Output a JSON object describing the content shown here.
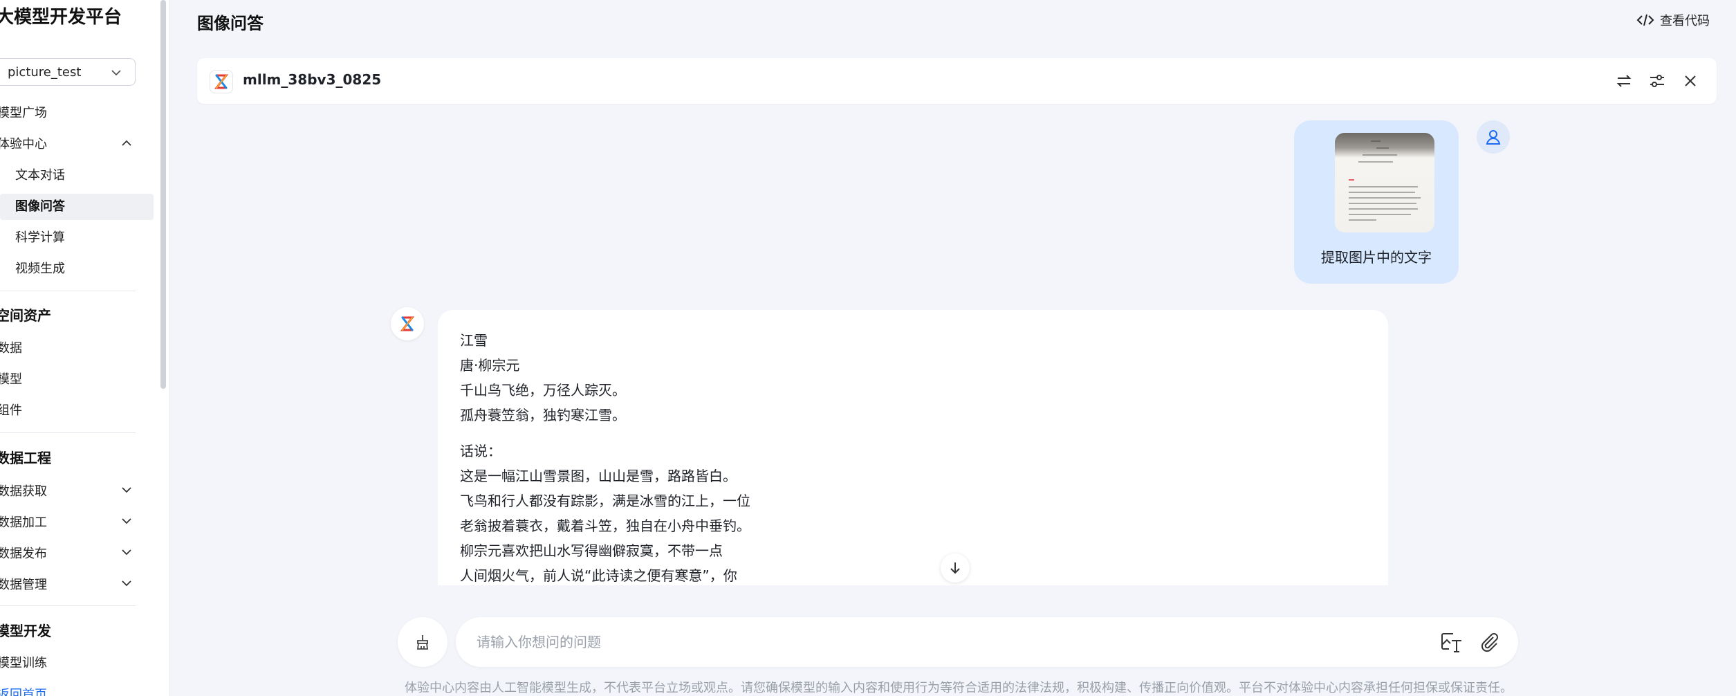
{
  "sidebar": {
    "title": "大模型开发平台",
    "project": "picture_test",
    "items": {
      "model_square": "模型广场",
      "experience_center": "体验中心",
      "text_chat": "文本对话",
      "image_qa": "图像问答",
      "science_calc": "科学计算",
      "video_gen": "视频生成",
      "space_assets": "空间资产",
      "data": "数据",
      "model": "模型",
      "component": "组件",
      "data_engineering": "数据工程",
      "data_acquire": "数据获取",
      "data_process": "数据加工",
      "data_publish": "数据发布",
      "data_manage": "数据管理",
      "model_dev": "模型开发",
      "model_train": "模型训练",
      "back_home": "返回首页"
    }
  },
  "header": {
    "title": "图像问答",
    "view_code": "查看代码"
  },
  "model_bar": {
    "name": "mllm_38bv3_0825"
  },
  "chat": {
    "user_question": "提取图片中的文字",
    "answer_lines": [
      "江雪",
      "唐·柳宗元",
      "千山鸟飞绝，万径人踪灭。",
      "孤舟蓑笠翁，独钓寒江雪。",
      "话说：",
      "这是一幅江山雪景图，山山是雪，路路皆白。",
      "飞鸟和行人都没有踪影，满是冰雪的江上，一位",
      "老翁披着蓑衣，戴着斗笠，独自在小舟中垂钓。",
      "柳宗元喜欢把山水写得幽僻寂寞，不带一点",
      "人间烟火气，前人说“此诗读之便有寒意”，你"
    ]
  },
  "input": {
    "placeholder": "请输入你想问的问题"
  },
  "footer": {
    "disclaimer": "体验中心内容由人工智能模型生成，不代表平台立场或观点。请您确保模型的输入内容和使用行为等符合适用的法律法规，积极构建、传播正向价值观。平台不对体验中心内容承担任何担保或保证责任。"
  },
  "icons": {
    "chevron": "chevron-down-icon",
    "code": "code-icon",
    "swap": "swap-icon",
    "settings": "sliders-icon",
    "close": "close-icon",
    "user": "user-icon",
    "clear": "broom-icon",
    "image_text": "image-text-icon",
    "attach": "paperclip-icon",
    "scroll": "arrow-down-icon"
  },
  "colors": {
    "accent": "#1b6cf2",
    "user_bubble": "#d7e8ff",
    "background": "#f3f5fa"
  }
}
